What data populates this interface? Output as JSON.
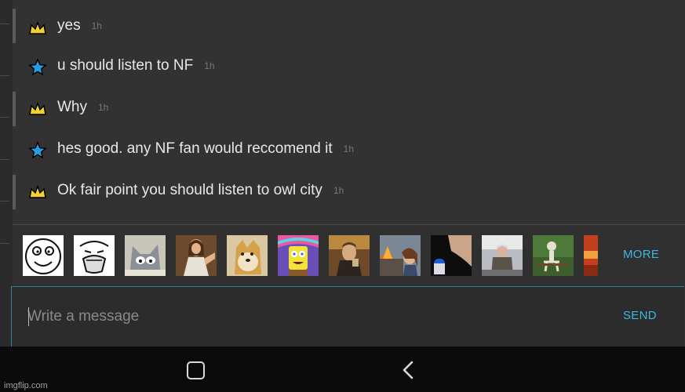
{
  "messages": [
    {
      "text": "yes",
      "time": "1h",
      "icon": "crown-icon"
    },
    {
      "text": "u should listen to NF",
      "time": "1h",
      "icon": "star-icon"
    },
    {
      "text": "Why",
      "time": "1h",
      "icon": "crown-icon"
    },
    {
      "text": "hes good. any NF fan would reccomend it",
      "time": "1h",
      "icon": "star-icon"
    },
    {
      "text": "Ok fair point you should listen to owl city",
      "time": "1h",
      "icon": "crown-icon"
    }
  ],
  "meme_strip": {
    "items": [
      "rage-face-meme",
      "lol-face-meme",
      "tom-cat-meme",
      "jesus-meme",
      "doge-meme",
      "spongebob-imagination-meme",
      "leonardo-laughing-meme",
      "disaster-girl-meme",
      "pills-meme",
      "bernie-mittens-meme",
      "skeleton-bench-meme",
      "partial-meme"
    ],
    "more_label": "MORE"
  },
  "composer": {
    "placeholder": "Write a message",
    "send_label": "SEND"
  },
  "watermark": "imgflip.com",
  "colors": {
    "accent": "#3db8e0",
    "crown": "#f2d22e",
    "star": "#2b9be4"
  }
}
